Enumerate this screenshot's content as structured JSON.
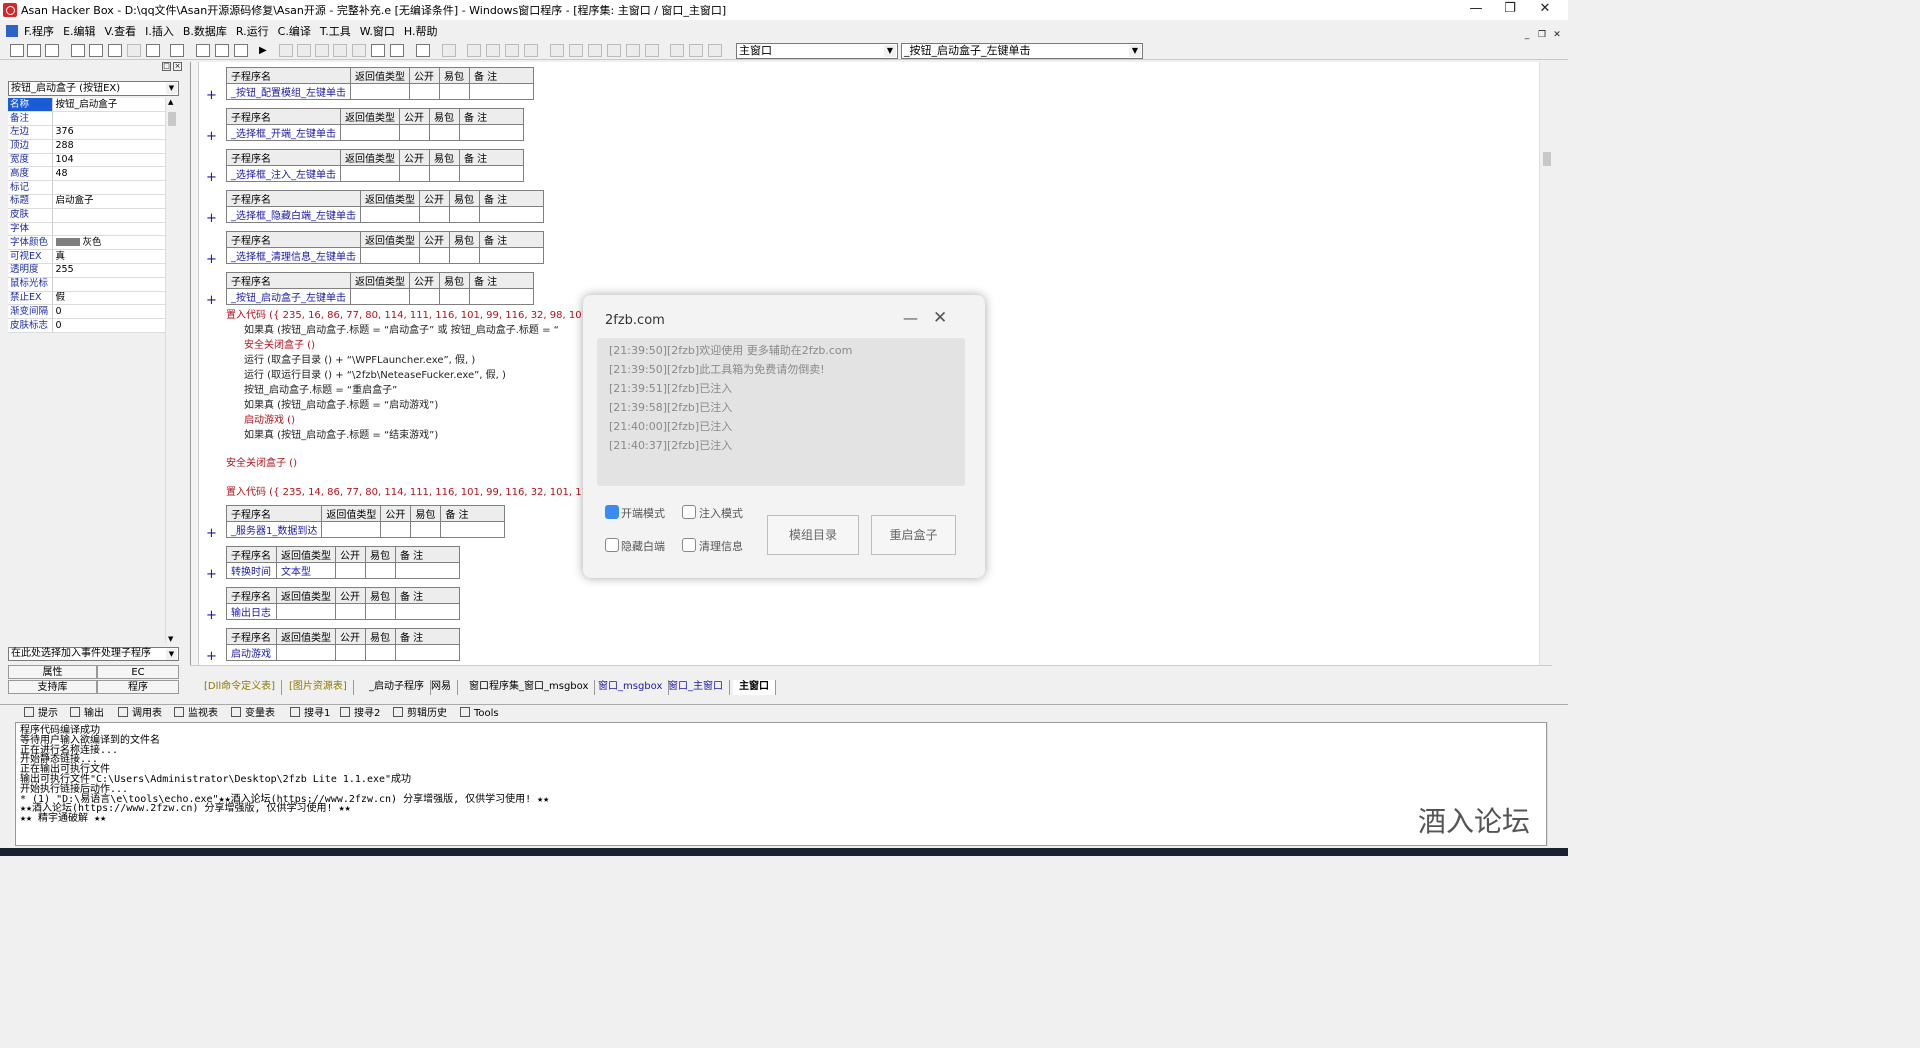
{
  "window": {
    "title": "Asan Hacker Box - D:\\qq文件\\Asan开源源码修复\\Asan开源 - 完整补充.e [无编译条件] - Windows窗口程序 - [程序集: 主窗口 / 窗口_主窗口]",
    "min_label": "—",
    "max_label": "❐",
    "close_label": "✕"
  },
  "menu": [
    "F.程序",
    "E.编辑",
    "V.查看",
    "I.插入",
    "B.数据库",
    "R.运行",
    "C.编译",
    "T.工具",
    "W.窗口",
    "H.帮助"
  ],
  "toolbar": {
    "combo_left": "主窗口",
    "combo_right": "_按钮_启动盒子_左键单击"
  },
  "properties": {
    "selector": "按钮_启动盒子 (按钮EX)",
    "rows": [
      {
        "name": "名称",
        "value": "按钮_启动盒子"
      },
      {
        "name": "备注",
        "value": ""
      },
      {
        "name": "左边",
        "value": "376"
      },
      {
        "name": "顶边",
        "value": "288"
      },
      {
        "name": "宽度",
        "value": "104"
      },
      {
        "name": "高度",
        "value": "48"
      },
      {
        "name": "标记",
        "value": ""
      },
      {
        "name": "标题",
        "value": "启动盒子"
      },
      {
        "name": "皮肤",
        "value": ""
      },
      {
        "name": "字体",
        "value": ""
      },
      {
        "name": "字体颜色",
        "value": "灰色"
      },
      {
        "name": "可视EX",
        "value": "真"
      },
      {
        "name": "透明度",
        "value": "255"
      },
      {
        "name": "鼠标光标",
        "value": ""
      },
      {
        "name": "禁止EX",
        "value": "假"
      },
      {
        "name": "渐变间隔",
        "value": "0"
      },
      {
        "name": "皮肤标志",
        "value": "0"
      }
    ],
    "event_combo": "在此处选择加入事件处理子程序",
    "tabs": {
      "props": "属性",
      "ec": "EC",
      "lib": "支持库",
      "prog": "程序"
    }
  },
  "editor": {
    "header": [
      "子程序名",
      "返回值类型",
      "公开",
      "易包",
      "备 注"
    ],
    "subs": [
      "_按钮_配置模组_左键单击",
      "_选择框_开端_左键单击",
      "_选择框_注入_左键单击",
      "_选择框_隐藏白端_左键单击",
      "_选择框_清理信息_左键单击",
      "_按钮_启动盒子_左键单击"
    ],
    "code_lines": [
      "置入代码 ({ 235, 16, 86, 77, 80, 114, 111, 116, 101, 99, 116, 32, 98, 101",
      "如果真 (按钮_启动盒子.标题 = “启动盒子” 或 按钮_启动盒子.标题 = “",
      "安全关闭盒子 ()",
      "运行 (取盒子目录 () + “\\WPFLauncher.exe”, 假, )",
      "运行 (取运行目录 () + “\\2fzb\\NeteaseFucker.exe”, 假, )",
      "按钮_启动盒子.标题 = “重启盒子”",
      "如果真 (按钮_启动盒子.标题 = “启动游戏”)",
      "启动游戏 ()",
      "如果真 (按钮_启动盒子.标题 = “结束游戏”)",
      "安全关闭盒子 ()",
      "置入代码 ({ 235, 14, 86, 77, 80, 114, 111, 116, 101, 99, 116, 32, 101, 111"
    ],
    "subs2": [
      {
        "name": "_服务器1_数据到达",
        "ret": ""
      },
      {
        "name": "转换时间",
        "ret": "文本型"
      },
      {
        "name": "输出日志",
        "ret": ""
      },
      {
        "name": "启动游戏",
        "ret": ""
      }
    ]
  },
  "dialog": {
    "title": "2fzb.com",
    "min_label": "—",
    "close_label": "✕",
    "log": [
      "[21:39:50][2fzb]欢迎使用 更多辅助在2fzb.com",
      "[21:39:50][2fzb]此工具箱为免费请勿倒卖!",
      "[21:39:51][2fzb]已注入",
      "[21:39:58][2fzb]已注入",
      "[21:40:00][2fzb]已注入",
      "[21:40:37][2fzb]已注入"
    ],
    "checkboxes": [
      {
        "label": "开端模式",
        "checked": true
      },
      {
        "label": "注入模式",
        "checked": false
      },
      {
        "label": "隐藏白端",
        "checked": false
      },
      {
        "label": "清理信息",
        "checked": false
      }
    ],
    "btn_mod": "模组目录",
    "btn_restart": "重启盒子"
  },
  "code_tabs": [
    "[Dll命令定义表]",
    "[图片资源表]",
    "_启动子程序",
    "网易",
    "窗口程序集_窗口_msgbox",
    "窗口_msgbox",
    "窗口_主窗口",
    "主窗口"
  ],
  "output_tabs": [
    "提示",
    "输出",
    "调用表",
    "监视表",
    "变量表",
    "搜寻1",
    "搜寻2",
    "剪辑历史",
    "Tools"
  ],
  "output_lines": [
    "程序代码编译成功",
    "等待用户输入欲编译到的文件名",
    "正在进行名称连接...",
    "开始静态链接...",
    "正在输出可执行文件",
    "输出可执行文件\"C:\\Users\\Administrator\\Desktop\\2fzb Lite 1.1.exe\"成功",
    "开始执行链接后动作...",
    "* (1) \"D:\\易语言\\e\\tools\\echo.exe\"★★酒入论坛(https://www.2fzw.cn) 分享增强版, 仅供学习使用! ★★",
    "★★酒入论坛(https://www.2fzw.cn) 分享增强版, 仅供学习使用! ★★",
    "★★ 精宇通破解 ★★"
  ],
  "watermark": "酒入论坛"
}
